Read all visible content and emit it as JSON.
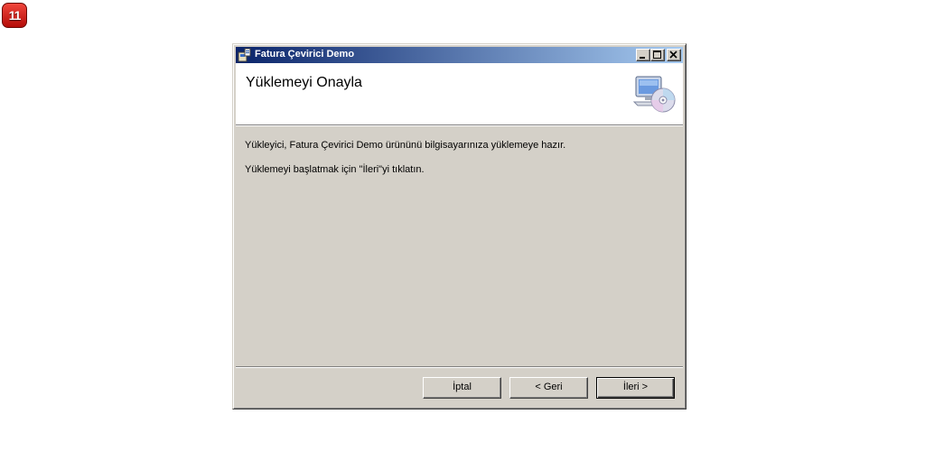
{
  "badge": {
    "number": "11"
  },
  "window": {
    "title": "Fatura Çevirici Demo",
    "header_title": "Yüklemeyi Onayla",
    "header_icon": "computer-cd-icon"
  },
  "body": {
    "line1": "Yükleyici, Fatura Çevirici Demo ürününü bilgisayarınıza yüklemeye hazır.",
    "line2": "Yüklemeyi başlatmak için \"İleri\"yi tıklatın."
  },
  "buttons": {
    "cancel": "İptal",
    "back": "< Geri",
    "next": "İleri >"
  },
  "colors": {
    "titlebar_start": "#0a246a",
    "titlebar_end": "#a6caf0",
    "dialog_bg": "#d4d0c8",
    "badge": "#d8201a"
  }
}
